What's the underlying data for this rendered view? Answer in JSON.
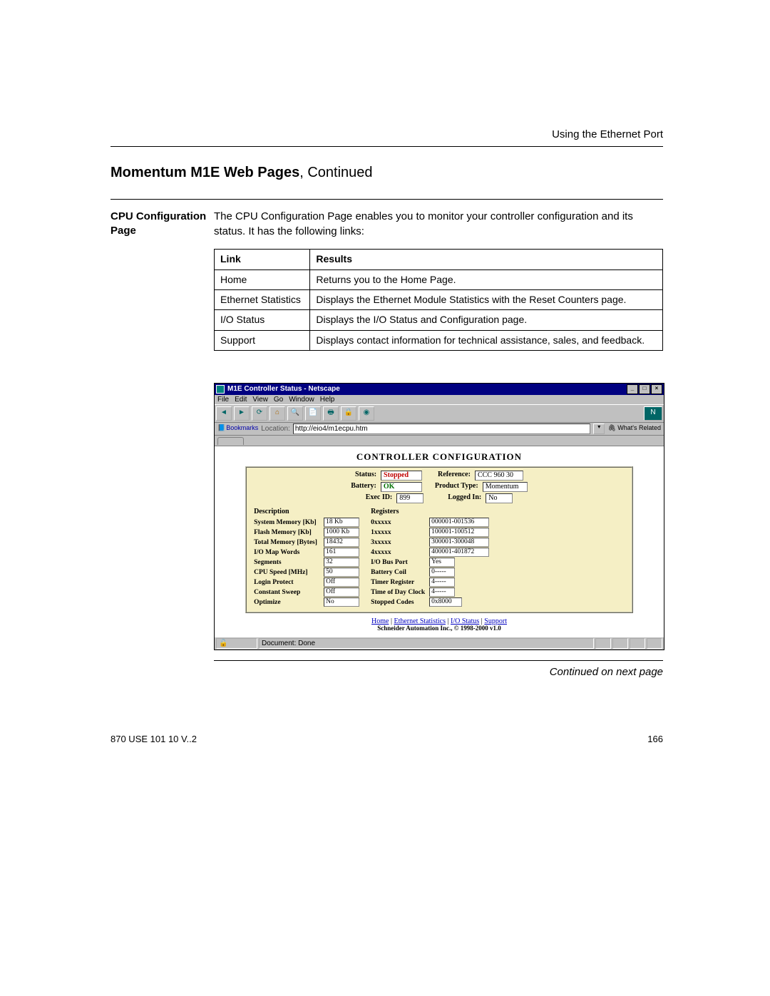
{
  "header": {
    "right": "Using the Ethernet Port"
  },
  "title": {
    "bold": "Momentum M1E Web Pages",
    "tail": ", Continued"
  },
  "side": {
    "heading": "CPU Configuration Page"
  },
  "intro": "The CPU Configuration Page enables you to monitor your controller configuration and its status. It has the following links:",
  "table": {
    "head": {
      "c1": "Link",
      "c2": "Results"
    },
    "rows": [
      {
        "c1": "Home",
        "c2": "Returns you to the Home Page."
      },
      {
        "c1": "Ethernet Statistics",
        "c2": "Displays the Ethernet Module Statistics with the Reset Counters page."
      },
      {
        "c1": "I/O Status",
        "c2": "Displays the I/O Status and Configuration page."
      },
      {
        "c1": "Support",
        "c2": "Displays contact information for technical assistance, sales, and feedback."
      }
    ]
  },
  "browser": {
    "title": "M1E Controller Status - Netscape",
    "menu": [
      "File",
      "Edit",
      "View",
      "Go",
      "Window",
      "Help"
    ],
    "bookmarks": "Bookmarks",
    "location_lbl": "Location:",
    "location_val": "http://eio4/m1ecpu.htm",
    "related": "What's Related",
    "status": "Document: Done"
  },
  "cc": {
    "title": "CONTROLLER CONFIGURATION",
    "row1": {
      "status_lbl": "Status:",
      "status_val": "Stopped",
      "ref_lbl": "Reference:",
      "ref_val": "CCC 960 30"
    },
    "row2": {
      "batt_lbl": "Battery:",
      "batt_val": "OK",
      "ptype_lbl": "Product Type:",
      "ptype_val": "Momentum"
    },
    "row3": {
      "exec_lbl": "Exec ID:",
      "exec_val": "899",
      "logged_lbl": "Logged In:",
      "logged_val": "No"
    },
    "desc_h": "Description",
    "reg_h": "Registers",
    "left": [
      {
        "l": "System Memory [Kb]",
        "v": "18 Kb"
      },
      {
        "l": "Flash Memory [Kb]",
        "v": "1000 Kb"
      },
      {
        "l": "Total Memory [Bytes]",
        "v": "18432"
      },
      {
        "l": "I/O Map Words",
        "v": "161"
      },
      {
        "l": "Segments",
        "v": "32"
      },
      {
        "l": "CPU Speed [MHz]",
        "v": "50"
      },
      {
        "l": "Login Protect",
        "v": "Off"
      },
      {
        "l": "Constant Sweep",
        "v": "Off"
      },
      {
        "l": "Optimize",
        "v": "No"
      }
    ],
    "right": [
      {
        "l": "0xxxxx",
        "v": "000001-001536"
      },
      {
        "l": "1xxxxx",
        "v": "100001-100512"
      },
      {
        "l": "3xxxxx",
        "v": "300001-300048"
      },
      {
        "l": "4xxxxx",
        "v": "400001-401872"
      },
      {
        "l": "I/O Bus Port",
        "v": "Yes"
      },
      {
        "l": "Battery Coil",
        "v": "0-----"
      },
      {
        "l": "Timer Register",
        "v": "4-----"
      },
      {
        "l": "Time of Day Clock",
        "v": "4-----"
      },
      {
        "l": "Stopped Codes",
        "v": "0x8000"
      }
    ],
    "links": {
      "home": "Home",
      "eth": "Ethernet Statistics",
      "io": "I/O Status",
      "sup": "Support"
    },
    "copyright": "Schneider Automation Inc., © 1998-2000 v1.0"
  },
  "contnext": "Continued on next page",
  "footer": {
    "left": "870 USE 101 10 V..2",
    "right": "166"
  }
}
